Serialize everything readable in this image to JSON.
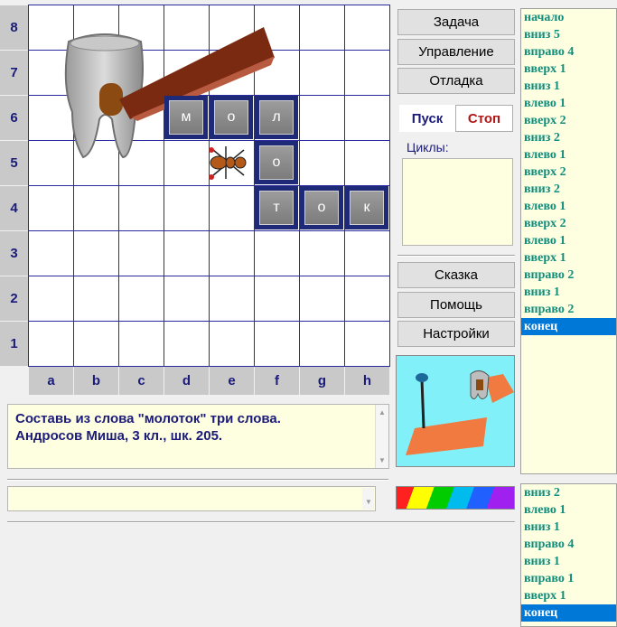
{
  "board": {
    "rows": [
      "8",
      "7",
      "6",
      "5",
      "4",
      "3",
      "2",
      "1"
    ],
    "cols": [
      "a",
      "b",
      "c",
      "d",
      "e",
      "f",
      "g",
      "h"
    ],
    "tiles": [
      {
        "letter": "м",
        "col": 3,
        "row": 2
      },
      {
        "letter": "о",
        "col": 4,
        "row": 2
      },
      {
        "letter": "л",
        "col": 5,
        "row": 2
      },
      {
        "letter": "о",
        "col": 5,
        "row": 3
      },
      {
        "letter": "т",
        "col": 5,
        "row": 4
      },
      {
        "letter": "о",
        "col": 6,
        "row": 4
      },
      {
        "letter": "к",
        "col": 7,
        "row": 4
      }
    ]
  },
  "buttons": {
    "task": "Задача",
    "control": "Управление",
    "debug": "Отладка",
    "run": "Пуск",
    "stop": "Стоп",
    "tale": "Сказка",
    "help": "Помощь",
    "settings": "Настройки"
  },
  "cycles_label": "Циклы:",
  "task_text": {
    "line1": "Составь из слова \"молоток\" три слова.",
    "line2": "Андросов Миша, 3 кл., шк. 205."
  },
  "program": [
    "начало",
    "вниз 5",
    "вправо 4",
    "вверх 1",
    "вниз 1",
    "влево 1",
    "вверх 2",
    "вниз 2",
    "влево 1",
    "вверх 2",
    "вниз 2",
    "влево 1",
    "вверх 2",
    "влево 1",
    "вверх 1",
    "вправо 2",
    "вниз 1",
    "вправо 2",
    "конец"
  ],
  "program2": [
    "вниз 2",
    "влево 1",
    "вниз 1",
    "вправо 4",
    "вниз 1",
    "вправо 1",
    "вверх 1",
    "конец"
  ],
  "colors": {
    "code_text": "#108e7c",
    "selection": "#0078d7",
    "field_bg": "#fefee0",
    "tile_frame": "#1e2a78"
  }
}
